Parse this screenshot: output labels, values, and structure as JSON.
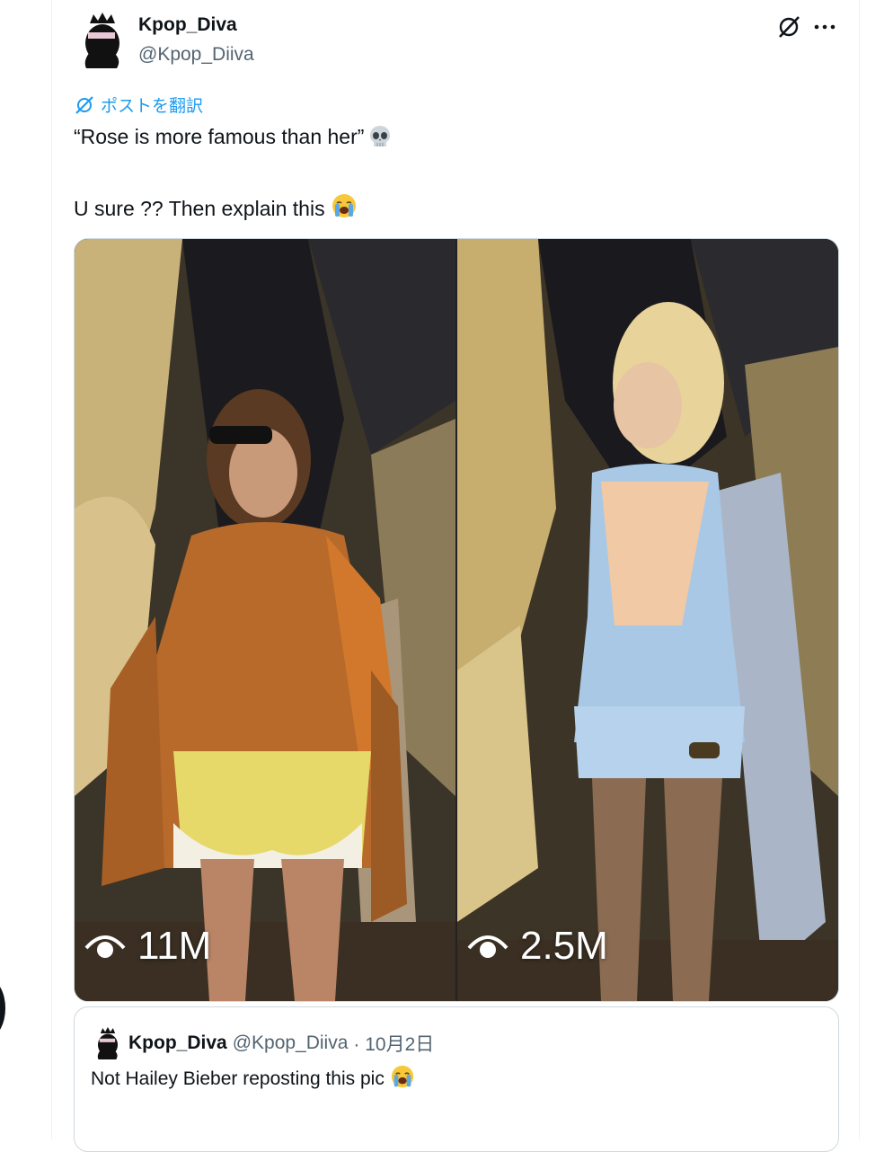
{
  "author": {
    "name": "Kpop_Diva",
    "handle": "@Kpop_Diiva"
  },
  "translate_label": "ポストを翻訳",
  "tweet": {
    "line1": "“Rose is more famous than her”",
    "line2": "U sure ?? Then explain this"
  },
  "media": {
    "left_views": "11M",
    "right_views": "2.5M"
  },
  "quote": {
    "name": "Kpop_Diva",
    "handle": "@Kpop_Diiva",
    "date": "· 10月2日",
    "text": "Not Hailey Bieber reposting this pic"
  },
  "icons": {
    "grok": "grok-icon",
    "more": "more-icon",
    "translate": "translate-icon",
    "skull": "skull-emoji-icon",
    "crying": "crying-emoji-icon",
    "eye": "eye-icon"
  },
  "colors": {
    "accent": "#1d9bf0",
    "text": "#0f1419",
    "muted": "#536471"
  }
}
